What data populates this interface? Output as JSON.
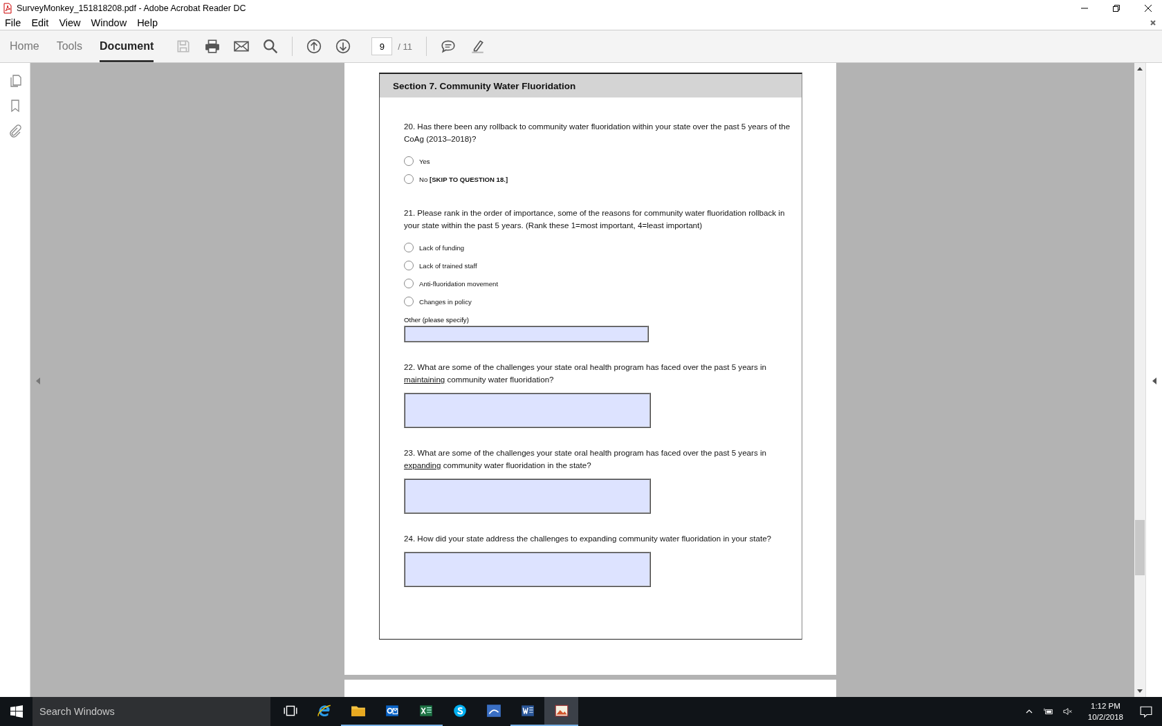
{
  "window": {
    "title": "SurveyMonkey_151818208.pdf - Adobe Acrobat Reader DC"
  },
  "menu": [
    "File",
    "Edit",
    "View",
    "Window",
    "Help"
  ],
  "tabs": [
    {
      "label": "Home",
      "selected": false
    },
    {
      "label": "Tools",
      "selected": false
    },
    {
      "label": "Document",
      "selected": true
    }
  ],
  "page_nav": {
    "current": "9",
    "total": "/ 11"
  },
  "document": {
    "section_title": "Section 7. Community Water Fluoridation",
    "questions": [
      {
        "kind": "radio",
        "text": "20. Has there been any rollback to community water fluoridation within your state over the past 5 years of the CoAg (2013–2018)?",
        "options": [
          {
            "label": "Yes",
            "checked": false
          },
          {
            "label": "No **[SKIP TO QUESTION 18.]**",
            "checked": false
          }
        ]
      },
      {
        "kind": "radio",
        "text": "21. Please rank in the order of importance, some of the reasons for community water fluoridation rollback in your state within the past 5 years. (Rank these 1=most important, 4=least important)",
        "options": [
          {
            "label": "Lack of funding",
            "checked": false
          },
          {
            "label": "Lack of trained staff",
            "checked": false
          },
          {
            "label": "Anti-fluoridation movement",
            "checked": false
          },
          {
            "label": "Changes in policy",
            "checked": false
          }
        ],
        "other_label": "Other (please specify)"
      },
      {
        "kind": "essay",
        "text": "22. What are some of the challenges your state oral health program has faced over the past 5 years in",
        "underlined": "maintaining",
        "text_after": "community water fluoridation?"
      },
      {
        "kind": "essay",
        "text": "23. What are some of the challenges your state oral health program has faced over the past 5 years in",
        "underlined": "expanding",
        "text_after": "community water fluoridation in the state?"
      },
      {
        "kind": "essay",
        "text": "24. How did your state address the challenges to expanding community water fluoridation in your state?"
      }
    ]
  },
  "taskbar": {
    "search_placeholder": "Search Windows",
    "apps": [
      {
        "kind": "taskview",
        "running": false,
        "selected": false
      },
      {
        "kind": "browser",
        "running": false,
        "selected": false
      },
      {
        "kind": "folder",
        "running": true,
        "selected": false
      },
      {
        "kind": "mail",
        "running": true,
        "selected": false
      },
      {
        "kind": "spreadsheet",
        "running": true,
        "selected": false
      },
      {
        "kind": "chat",
        "running": false,
        "selected": false
      },
      {
        "kind": "stats",
        "running": false,
        "selected": false
      },
      {
        "kind": "word",
        "running": true,
        "selected": false
      },
      {
        "kind": "pdf",
        "running": true,
        "selected": true
      }
    ],
    "time": "1:12 PM",
    "date": "10/2/2018"
  }
}
